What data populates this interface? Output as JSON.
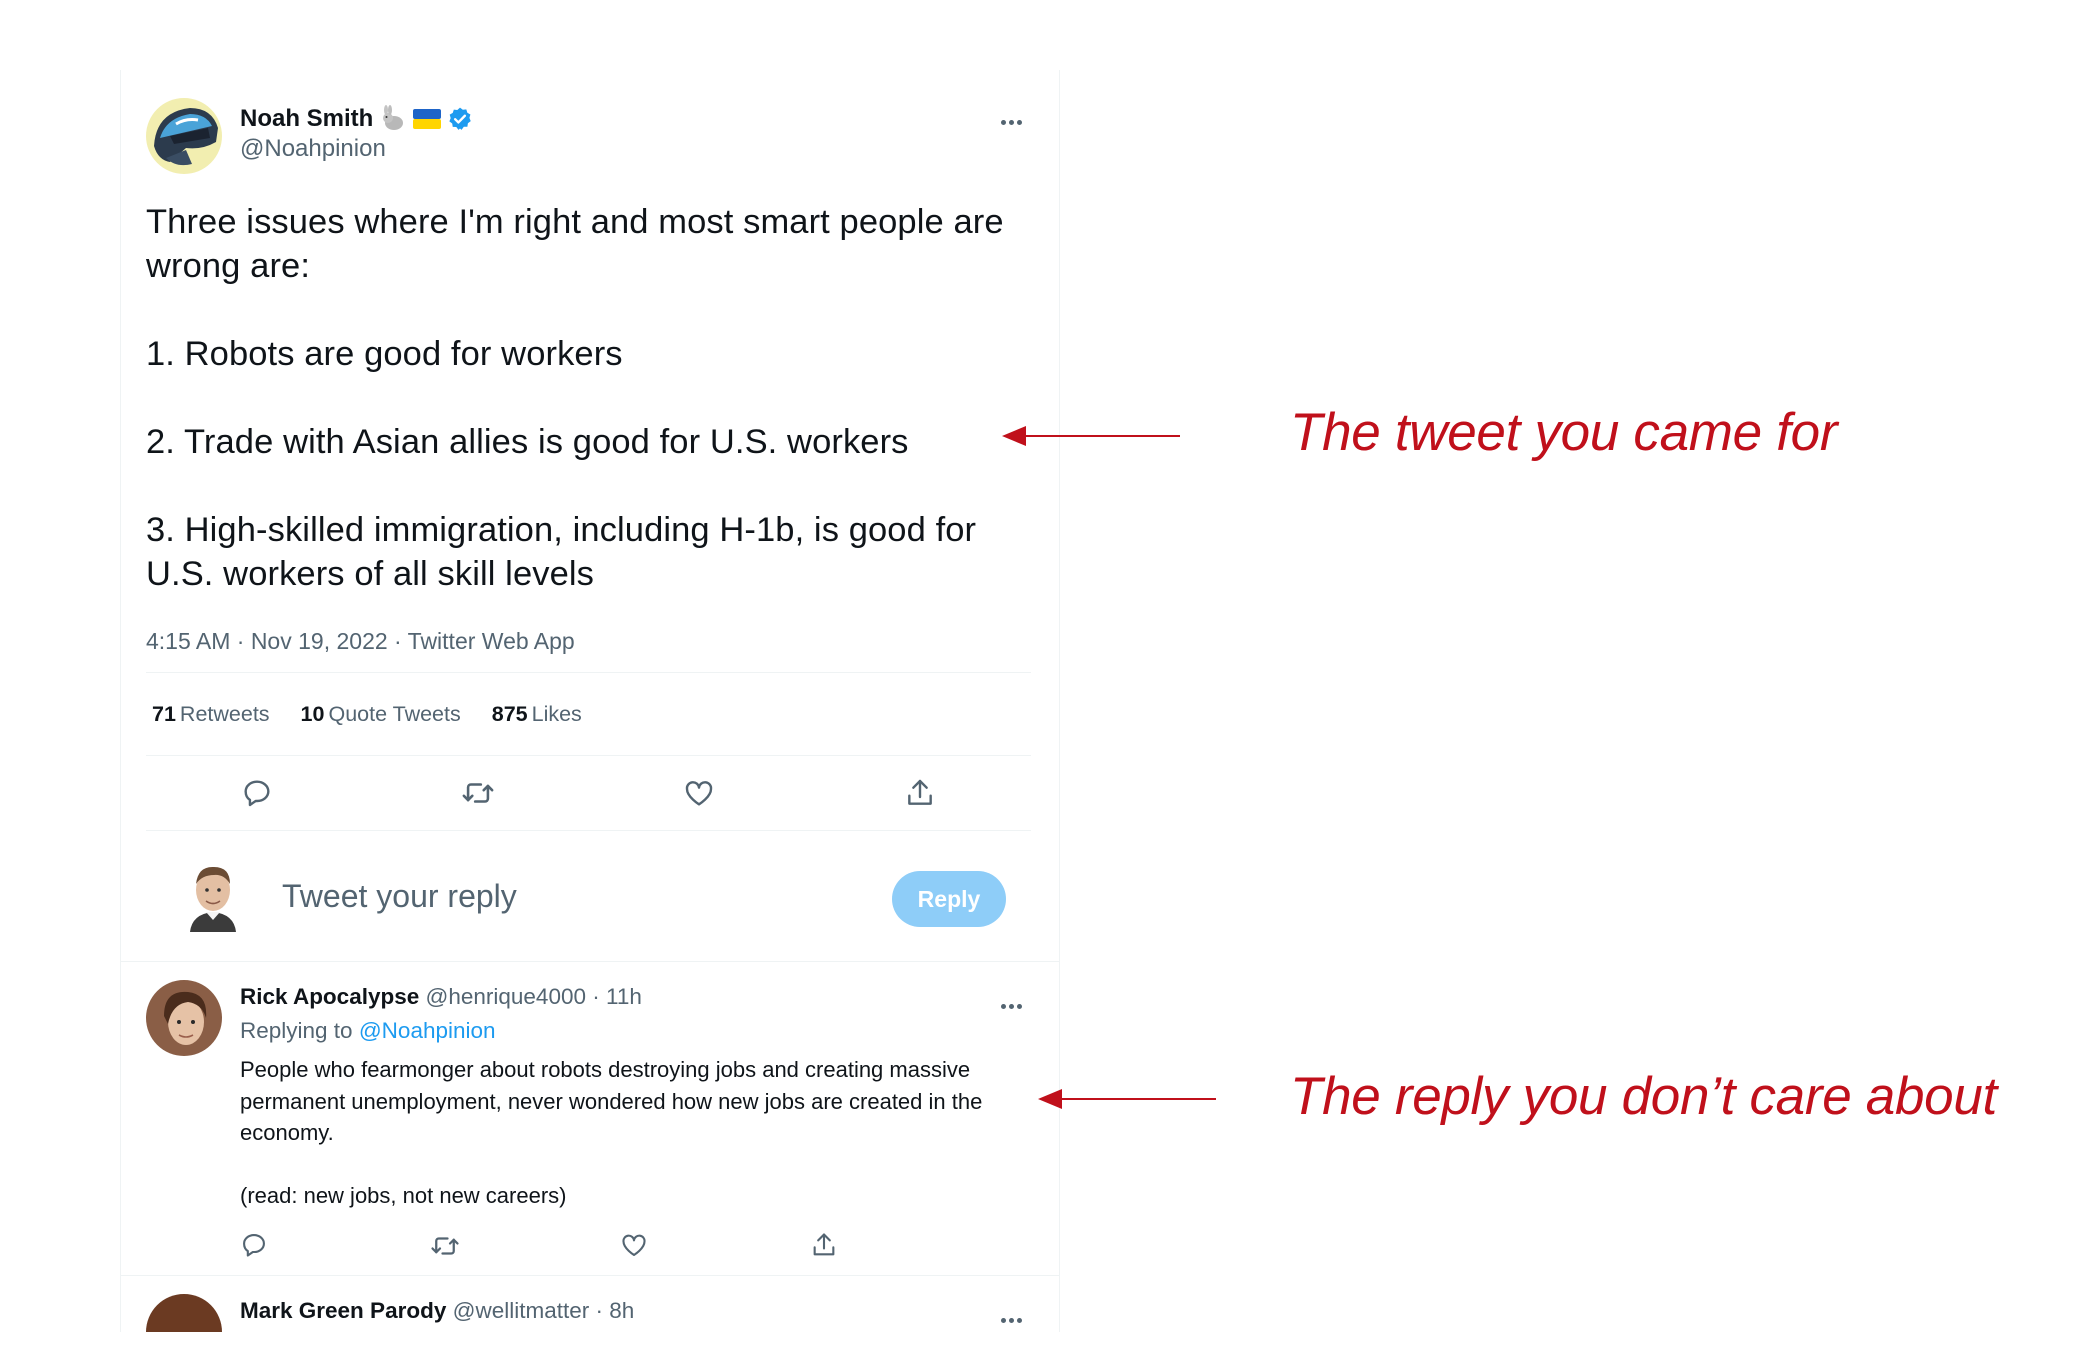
{
  "main_tweet": {
    "author_name": "Noah Smith",
    "author_handle": "@Noahpinion",
    "avatar_icon": "helmet-avatar",
    "name_emojis": [
      "rabbit-icon",
      "ukraine-flag-icon",
      "verified-badge-icon"
    ],
    "text_paragraphs": [
      "Three issues where I'm right and most smart people are wrong are:",
      "1. Robots are good for workers",
      "2. Trade with Asian allies is good for U.S. workers",
      "3. High-skilled immigration, including H-1b, is good for U.S. workers of all skill levels"
    ],
    "meta": "4:15 AM · Nov 19, 2022 · Twitter Web App",
    "stats": {
      "retweets_count": "71",
      "retweets_label": "Retweets",
      "quotes_count": "10",
      "quotes_label": "Quote Tweets",
      "likes_count": "875",
      "likes_label": "Likes"
    },
    "actions": [
      "reply-icon",
      "retweet-icon",
      "like-icon",
      "share-icon"
    ]
  },
  "reply_composer": {
    "placeholder": "Tweet your reply",
    "button_label": "Reply"
  },
  "replies": [
    {
      "name": "Rick Apocalypse",
      "handle": "@henrique4000",
      "time": "· 11h",
      "replying_prefix": "Replying to",
      "replying_handle": "@Noahpinion",
      "paragraphs": [
        "People who fearmonger about robots destroying jobs and creating massive permanent unemployment, never wondered how new jobs are created in the economy.",
        "(read: new jobs, not new careers)"
      ]
    },
    {
      "name": "Mark Green Parody",
      "handle": "@wellitmatter",
      "time": "· 8h"
    }
  ],
  "annotations": {
    "tweet_label": "The tweet you came for",
    "reply_label": "The reply you don’t care about",
    "color": "#c0101b"
  },
  "colors": {
    "accent": "#1d9bf0",
    "reply_button": "#8ecdf8",
    "secondary_text": "#536471",
    "annotation": "#c0101b"
  }
}
